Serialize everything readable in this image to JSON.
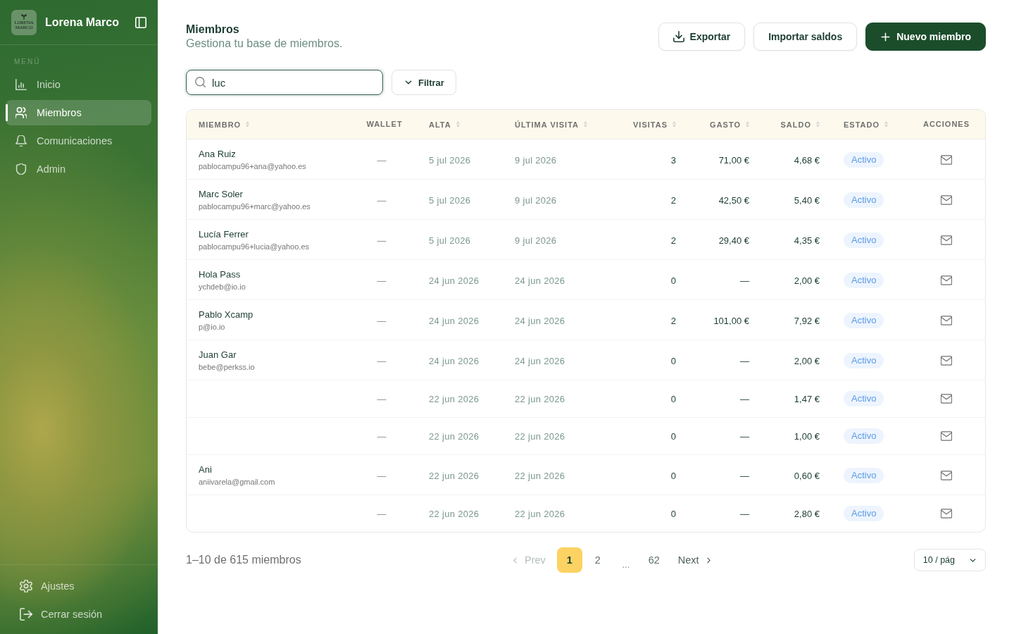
{
  "sidebar": {
    "brand": {
      "logo_text": "LORENA MARCO",
      "name": "Lorena Marco"
    },
    "section_label": "MENÚ",
    "items": [
      {
        "label": "Inicio",
        "selected": false
      },
      {
        "label": "Miembros",
        "selected": true
      },
      {
        "label": "Comunicaciones",
        "selected": false
      },
      {
        "label": "Admin",
        "selected": false
      }
    ],
    "footer_items": [
      {
        "label": "Ajustes"
      },
      {
        "label": "Cerrar sesión"
      }
    ]
  },
  "header": {
    "title": "Miembros",
    "subtitle": "Gestiona tu base de miembros.",
    "buttons": [
      {
        "label": "Exportar",
        "kind": "download"
      },
      {
        "label": "Importar saldos",
        "kind": "plain"
      },
      {
        "label": "Nuevo miembro",
        "kind": "create"
      }
    ]
  },
  "toolbar": {
    "search": {
      "value": "luc"
    },
    "filter_button": {
      "label": "Filtrar"
    }
  },
  "table": {
    "columns": [
      {
        "label": "MIEMBRO",
        "sortable": true
      },
      {
        "label": "WALLET",
        "sortable": false
      },
      {
        "label": "ALTA",
        "sortable": true
      },
      {
        "label": "ÚLTIMA VISITA",
        "sortable": true
      },
      {
        "label": "VISITAS",
        "sortable": true
      },
      {
        "label": "GASTO",
        "sortable": true
      },
      {
        "label": "SALDO",
        "sortable": true
      },
      {
        "label": "ESTADO",
        "sortable": true
      },
      {
        "label": "ACCIONES",
        "sortable": false
      }
    ],
    "rows": [
      {
        "member": {
          "name": "Ana Ruiz",
          "email": "pablocampu96+ana@yahoo.es"
        },
        "wallet": "—",
        "joined": "5 jul 2026",
        "last_visit": "9 jul 2026",
        "visits": "3",
        "spent": "71,00 €",
        "balance": "4,68 €",
        "status": "Activo"
      },
      {
        "member": {
          "name": "Marc Soler",
          "email": "pablocampu96+marc@yahoo.es"
        },
        "wallet": "—",
        "joined": "5 jul 2026",
        "last_visit": "9 jul 2026",
        "visits": "2",
        "spent": "42,50 €",
        "balance": "5,40 €",
        "status": "Activo"
      },
      {
        "member": {
          "name": "Lucía Ferrer",
          "email": "pablocampu96+lucia@yahoo.es"
        },
        "wallet": "—",
        "joined": "5 jul 2026",
        "last_visit": "9 jul 2026",
        "visits": "2",
        "spent": "29,40 €",
        "balance": "4,35 €",
        "status": "Activo"
      },
      {
        "member": {
          "name": "Hola Pass",
          "email": "ychdeb@io.io"
        },
        "wallet": "—",
        "joined": "24 jun 2026",
        "last_visit": "24 jun 2026",
        "visits": "0",
        "spent": "—",
        "balance": "2,00 €",
        "status": "Activo"
      },
      {
        "member": {
          "name": "Pablo Xcamp",
          "email": "p@io.io"
        },
        "wallet": "—",
        "joined": "24 jun 2026",
        "last_visit": "24 jun 2026",
        "visits": "2",
        "spent": "101,00 €",
        "balance": "7,92 €",
        "status": "Activo"
      },
      {
        "member": {
          "name": "Juan Gar",
          "email": "bebe@perkss.io"
        },
        "wallet": "—",
        "joined": "24 jun 2026",
        "last_visit": "24 jun 2026",
        "visits": "0",
        "spent": "—",
        "balance": "2,00 €",
        "status": "Activo"
      },
      {
        "wallet": "—",
        "joined": "22 jun 2026",
        "last_visit": "22 jun 2026",
        "visits": "0",
        "spent": "—",
        "balance": "1,47 €",
        "status": "Activo"
      },
      {
        "wallet": "—",
        "joined": "22 jun 2026",
        "last_visit": "22 jun 2026",
        "visits": "0",
        "spent": "—",
        "balance": "1,00 €",
        "status": "Activo"
      },
      {
        "member": {
          "name": "Ani",
          "email": "aniivarela@gmail.com"
        },
        "wallet": "—",
        "joined": "22 jun 2026",
        "last_visit": "22 jun 2026",
        "visits": "0",
        "spent": "—",
        "balance": "0,60 €",
        "status": "Activo"
      },
      {
        "wallet": "—",
        "joined": "22 jun 2026",
        "last_visit": "22 jun 2026",
        "visits": "0",
        "spent": "—",
        "balance": "2,80 €",
        "status": "Activo"
      }
    ]
  },
  "footer": {
    "summary": "1–10 de 615 miembros",
    "pagination": {
      "prev": {
        "label": "Prev",
        "disabled": true
      },
      "pages": [
        {
          "label": "1",
          "kind": "page",
          "selected": true
        },
        {
          "label": "2",
          "kind": "page",
          "selected": false
        },
        {
          "label": "...",
          "kind": "gap",
          "selected": false
        },
        {
          "label": "62",
          "kind": "page",
          "selected": false
        }
      ],
      "next": {
        "label": "Next",
        "disabled": false
      }
    },
    "page_size": {
      "value": "10 / pág"
    }
  }
}
